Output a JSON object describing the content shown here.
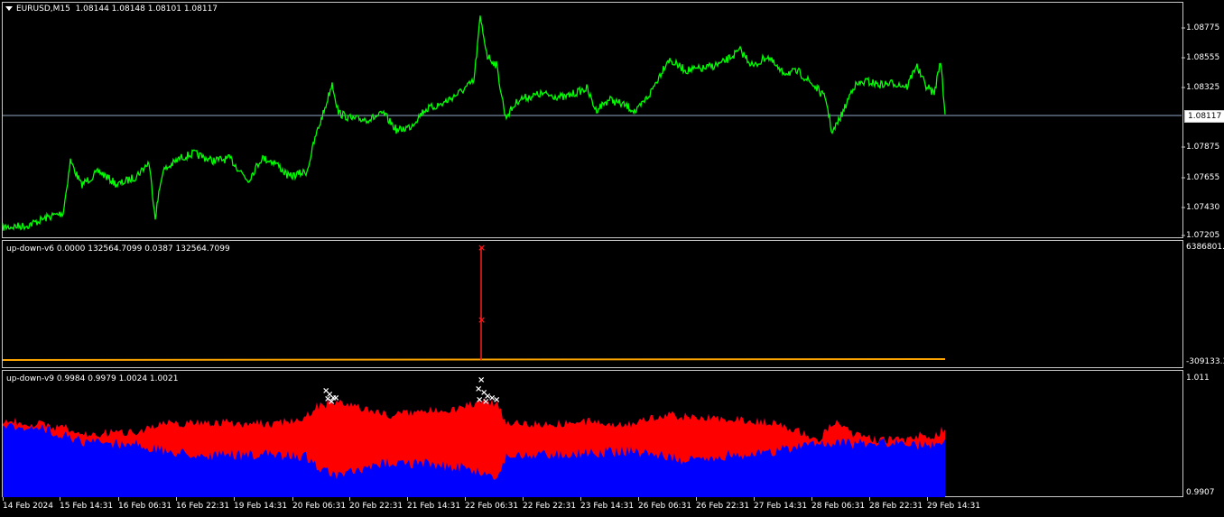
{
  "header": {
    "symbol": "EURUSD,M15",
    "quotes": "1.08144 1.08148 1.08101 1.08117"
  },
  "price_pane": {
    "ticks": [
      "1.08775",
      "1.08555",
      "1.08325",
      "1.07875",
      "1.07655",
      "1.07430",
      "1.07205"
    ],
    "current_price": "1.08117",
    "line_color": "#00ff00",
    "current_line_color": "#8fa7c8"
  },
  "v6_pane": {
    "label": "up-down-v6 0.0000 132564.7099 0.0387 132564.7099",
    "ticks": [
      "6386801.2",
      "-309133.3"
    ],
    "line_color": "#ffa500",
    "marker_color": "#ff1a1a"
  },
  "v9_pane": {
    "label": "up-down-v9 0.9984 0.9979 1.0024 1.0021",
    "ticks": [
      "1.011",
      "0.9907"
    ],
    "upper_color": "#ff0000",
    "lower_color": "#0000ff",
    "marker_color": "#ffffff"
  },
  "x_axis": {
    "labels": [
      "14 Feb 2024",
      "15 Feb 14:31",
      "16 Feb 06:31",
      "16 Feb 22:31",
      "19 Feb 14:31",
      "20 Feb 06:31",
      "20 Feb 22:31",
      "21 Feb 14:31",
      "22 Feb 06:31",
      "22 Feb 22:31",
      "23 Feb 14:31",
      "26 Feb 06:31",
      "26 Feb 22:31",
      "27 Feb 14:31",
      "28 Feb 06:31",
      "28 Feb 22:31",
      "29 Feb 14:31"
    ]
  }
}
